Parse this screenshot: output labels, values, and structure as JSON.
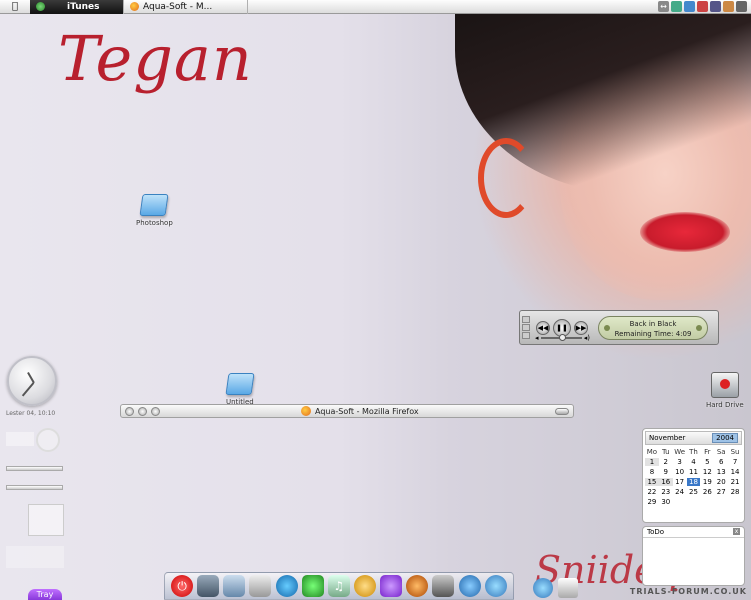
{
  "menubar": {
    "apple_icon": "apple-icon",
    "tasks": [
      {
        "label": "iTunes",
        "active": true,
        "icon": "itunes-icon"
      },
      {
        "label": "Aqua-Soft - M...",
        "active": false,
        "icon": "firefox-icon"
      }
    ]
  },
  "wallpaper": {
    "title": "Tegan",
    "signature": "Sniideq",
    "watermark": "TRIALS-FORUM.CO.UK"
  },
  "desktop_icons": [
    {
      "label": "Photoshop",
      "icon": "folder-icon"
    },
    {
      "label": "Untitled",
      "icon": "folder-icon"
    },
    {
      "label": "Hard Drive",
      "icon": "hard-drive-icon"
    }
  ],
  "firefox_window": {
    "title": "Aqua-Soft - Mozilla Firefox"
  },
  "player": {
    "track": "Back in Black",
    "remaining": "Remaining Time: 4:09",
    "volume_level": 0.55
  },
  "clock": {
    "label": "Lester 04, 10:10"
  },
  "calendar": {
    "month": "November",
    "year": "2004",
    "weekdays": [
      "Mo",
      "Tu",
      "We",
      "Th",
      "Fr",
      "Sa",
      "Su"
    ],
    "days": [
      "1",
      "2",
      "3",
      "4",
      "5",
      "6",
      "7",
      "8",
      "9",
      "10",
      "11",
      "12",
      "13",
      "14",
      "15",
      "16",
      "17",
      "18",
      "19",
      "20",
      "21",
      "22",
      "23",
      "24",
      "25",
      "26",
      "27",
      "28",
      "29",
      "30"
    ],
    "selected_day": "18"
  },
  "todo": {
    "title": "ToDo",
    "close_label": "x"
  },
  "tray": {
    "label": "Tray"
  },
  "colors": {
    "accent_red": "#b8202e",
    "calendar_selected": "#3a78c8",
    "tray_purple": "#9a45e8"
  }
}
